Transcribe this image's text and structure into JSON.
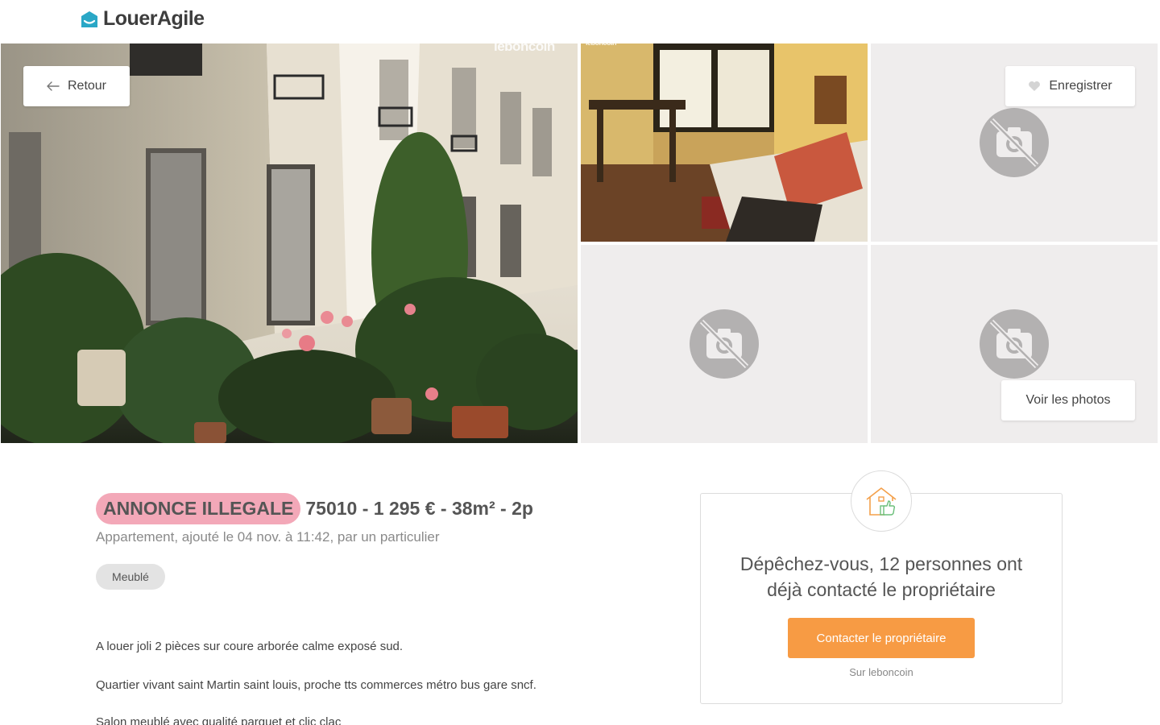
{
  "header": {
    "logo_text": "LouerAgile",
    "logo_color": "#2aa7c6"
  },
  "gallery": {
    "back_label": "Retour",
    "save_label": "Enregistrer",
    "see_photos_label": "Voir les photos",
    "watermark": "leboncoin",
    "placeholder_icon": "no-photo-icon"
  },
  "listing": {
    "illegal_badge": "ANNONCE ILLEGALE",
    "title": "75010 - 1 295 € - 38m² - 2p",
    "subtitle": "Appartement, ajouté le 04 nov. à 11:42, par un particulier",
    "chip": "Meublé",
    "description": [
      "A louer joli 2 pièces sur coure arborée calme exposé sud.",
      "Quartier vivant saint Martin saint louis, proche tts commerces métro bus gare sncf.",
      "Salon meublé avec qualité parquet et clic clac"
    ]
  },
  "contact_card": {
    "heading_line1": "Dépêchez-vous, 12 personnes ont",
    "heading_line2": "déjà contacté le propriétaire",
    "button_label": "Contacter le propriétaire",
    "source_label": "Sur leboncoin",
    "accent_color": "#f79b44"
  },
  "colors": {
    "illegal_badge": "#f3a8b8",
    "placeholder_bg": "#efeded"
  }
}
